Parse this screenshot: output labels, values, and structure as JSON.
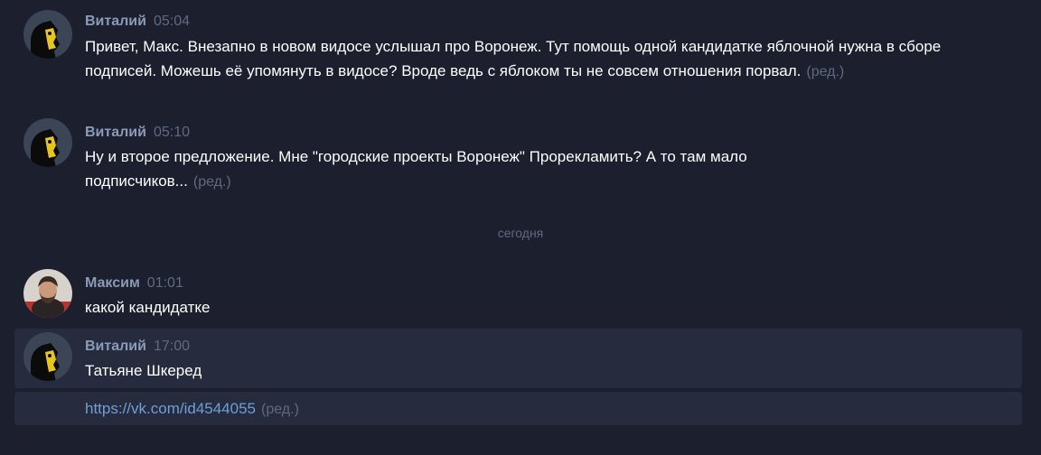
{
  "messages": [
    {
      "author": "Виталий",
      "time": "05:04",
      "text": "Привет, Макс. Внезапно в новом видосе услышал про Воронеж. Тут помощь одной кандидатке яблочной нужна в сборе подписей. Можешь её упомянуть в видосе? Вроде ведь с яблоком ты не совсем отношения порвал.",
      "edited": "(ред.)"
    },
    {
      "author": "Виталий",
      "time": "05:10",
      "text": "Ну и второе предложение. Мне \"городские проекты Воронеж\" Прорекламить? А то там мало подписчиков...",
      "edited": "(ред.)"
    },
    {
      "author": "Максим",
      "time": "01:01",
      "text": "какой кандидатке"
    },
    {
      "author": "Виталий",
      "time": "17:00",
      "text": "Татьяне Шкеред"
    },
    {
      "link": "https://vk.com/id4544055",
      "edited": "(ред.)"
    }
  ],
  "date_separator": "сегодня",
  "colors": {
    "background": "#1b1f2e",
    "highlight": "#262c3d",
    "author": "#8a9bb8",
    "meta": "#5f6a80",
    "link": "#6f9ed8"
  }
}
